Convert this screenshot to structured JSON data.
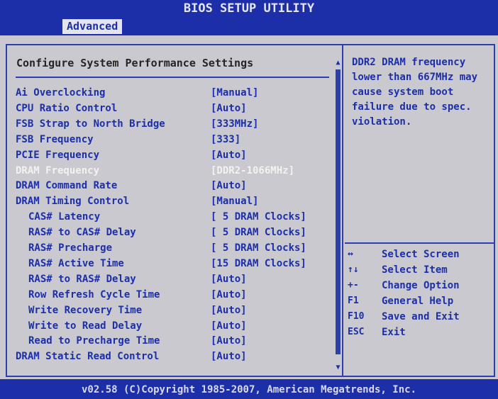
{
  "header": {
    "title": "BIOS SETUP UTILITY",
    "active_tab": "Advanced"
  },
  "main": {
    "heading": "Configure System Performance Settings",
    "settings": [
      {
        "label": "Ai Overclocking",
        "value": "[Manual]",
        "indent": false,
        "selected": false
      },
      {
        "label": "CPU Ratio Control",
        "value": "[Auto]",
        "indent": false,
        "selected": false
      },
      {
        "label": "FSB Strap to North Bridge",
        "value": "[333MHz]",
        "indent": false,
        "selected": false
      },
      {
        "label": "FSB Frequency",
        "value": "[333]",
        "indent": false,
        "selected": false
      },
      {
        "label": "PCIE Frequency",
        "value": "[Auto]",
        "indent": false,
        "selected": false
      },
      {
        "label": "DRAM Frequency",
        "value": "[DDR2-1066MHz]",
        "indent": false,
        "selected": true
      },
      {
        "label": "DRAM Command Rate",
        "value": "[Auto]",
        "indent": false,
        "selected": false
      },
      {
        "label": "DRAM Timing Control",
        "value": "[Manual]",
        "indent": false,
        "selected": false
      },
      {
        "label": "CAS# Latency",
        "value": "[ 5 DRAM Clocks]",
        "indent": true,
        "selected": false
      },
      {
        "label": "RAS# to CAS# Delay",
        "value": "[ 5 DRAM Clocks]",
        "indent": true,
        "selected": false
      },
      {
        "label": "RAS# Precharge",
        "value": "[ 5 DRAM Clocks]",
        "indent": true,
        "selected": false
      },
      {
        "label": "RAS# Active Time",
        "value": "[15 DRAM Clocks]",
        "indent": true,
        "selected": false
      },
      {
        "label": "RAS# to RAS# Delay",
        "value": "[Auto]",
        "indent": true,
        "selected": false
      },
      {
        "label": "Row Refresh Cycle Time",
        "value": "[Auto]",
        "indent": true,
        "selected": false
      },
      {
        "label": "Write Recovery Time",
        "value": "[Auto]",
        "indent": true,
        "selected": false
      },
      {
        "label": "Write to Read Delay",
        "value": "[Auto]",
        "indent": true,
        "selected": false
      },
      {
        "label": "Read to Precharge Time",
        "value": "[Auto]",
        "indent": true,
        "selected": false
      },
      {
        "label": "DRAM Static Read Control",
        "value": "[Auto]",
        "indent": false,
        "selected": false
      }
    ],
    "scroll_up_icon": "▲",
    "scroll_down_icon": "▼"
  },
  "help": {
    "lines": [
      "DDR2 DRAM frequency",
      "lower than 667MHz may",
      "cause system boot",
      "failure due to spec.",
      "violation."
    ],
    "keys": [
      {
        "key": "↔",
        "desc": "Select Screen",
        "icon": "left-right-arrow-icon"
      },
      {
        "key": "↑↓",
        "desc": "Select Item",
        "icon": "up-down-arrow-icon"
      },
      {
        "key": "+-",
        "desc": "Change Option",
        "icon": "plus-minus-icon"
      },
      {
        "key": "F1",
        "desc": "General Help",
        "icon": ""
      },
      {
        "key": "F10",
        "desc": "Save and Exit",
        "icon": ""
      },
      {
        "key": "ESC",
        "desc": "Exit",
        "icon": ""
      }
    ]
  },
  "footer": {
    "text": "v02.58 (C)Copyright 1985-2007, American Megatrends, Inc."
  },
  "colors": {
    "header_bg": "#1c2fa8",
    "body_bg": "#c9c9cf",
    "text_blue": "#1c2fa8",
    "selected_text": "#f2f2f2"
  }
}
